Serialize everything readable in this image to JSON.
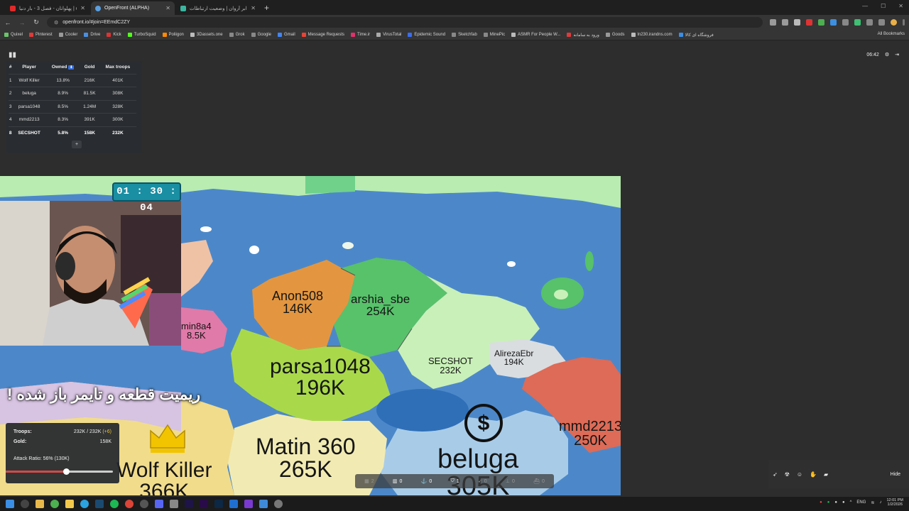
{
  "browser": {
    "tabs": [
      {
        "title": "پهلوانان - فصل 3 - بار دنیا | obe",
        "color": "#e02a2a",
        "active": false
      },
      {
        "title": "OpenFront (ALPHA)",
        "color": "#5aa0e0",
        "active": true
      },
      {
        "title": "رادار ابر آروان | وضعیت ارتباطات",
        "color": "#3cb5a0",
        "active": false
      }
    ],
    "url": "openfront.io/#join=EEmdC2ZY",
    "bookmarks": [
      "Quixel",
      "Pinterest",
      "Cooler",
      "Drive",
      "Kick",
      "TurboSquid",
      "Poliigon",
      "3Dassets.one",
      "Grok",
      "Google",
      "Gmail",
      "Message Requests",
      "Time.ir",
      "VirusTotal",
      "Epidemic Sound",
      "Sketchfab",
      "MinePic",
      "ASMR For People W...",
      "ورود به سامانه",
      "Goods",
      "ln230.irandns.com",
      "فروشگاه ای کالا"
    ],
    "all_bookmarks": "All Bookmarks"
  },
  "leaderboard": {
    "headers": [
      "#",
      "Player",
      "Owned",
      "Gold",
      "Max troops"
    ],
    "sort_badge": "⬇",
    "rows": [
      {
        "rank": "1",
        "player": "Wolf Killer",
        "owned": "13.8%",
        "gold": "216K",
        "troops": "401K",
        "me": false
      },
      {
        "rank": "2",
        "player": "beluga",
        "owned": "8.9%",
        "gold": "81.5K",
        "troops": "308K",
        "me": false
      },
      {
        "rank": "3",
        "player": "parsa1048",
        "owned": "8.5%",
        "gold": "1.24M",
        "troops": "328K",
        "me": false
      },
      {
        "rank": "4",
        "player": "mmd2213",
        "owned": "8.3%",
        "gold": "391K",
        "troops": "300K",
        "me": false
      },
      {
        "rank": "8",
        "player": "SECSHOT",
        "owned": "5.8%",
        "gold": "158K",
        "troops": "232K",
        "me": true
      }
    ],
    "expand_label": "+"
  },
  "game_clock": "06:42",
  "timer": "01 : 30 : 04",
  "overlay_caption": "ریمیت قطعه و تایمر باز شده !",
  "map_labels": [
    {
      "name": "Anon508",
      "value": "146K"
    },
    {
      "name": "arshia_sbe",
      "value": "254K"
    },
    {
      "name": "parsa1048",
      "value": "196K"
    },
    {
      "name": "SECSHOT",
      "value": "232K"
    },
    {
      "name": "AlirezaEbr",
      "value": "194K"
    },
    {
      "name": "mmd2213",
      "value": "250K"
    },
    {
      "name": "Matin 360",
      "value": "265K"
    },
    {
      "name": "beluga",
      "value": "305K"
    },
    {
      "name": "Wolf Killer",
      "value": "366K"
    },
    {
      "name": "min8a4",
      "value": "8.5K"
    }
  ],
  "stats": {
    "troops_label": "Troops:",
    "troops_value": "232K / 232K",
    "troops_plus": "(+6)",
    "gold_label": "Gold:",
    "gold_value": "158K",
    "attack_ratio_label": "Attack Ratio: 56% (130K)",
    "attack_ratio": 0.56
  },
  "bottom_bar": [
    "2",
    "0",
    "0",
    "1",
    "0",
    "0",
    "0"
  ],
  "right_tools_hide": "Hide",
  "taskbar": {
    "lang": "ENG",
    "time": "12:01 PM",
    "date": "1/2/2026"
  },
  "colors": {
    "ocean": "#4c88c9",
    "orange": "#e3963f",
    "green": "#57c26a",
    "lime": "#a9d94a",
    "pink": "#e07aa8",
    "red": "#dd6b57",
    "light_green": "#b8ecb0",
    "pale_yellow": "#f1ebb3",
    "light_blue": "#a8cce8"
  }
}
